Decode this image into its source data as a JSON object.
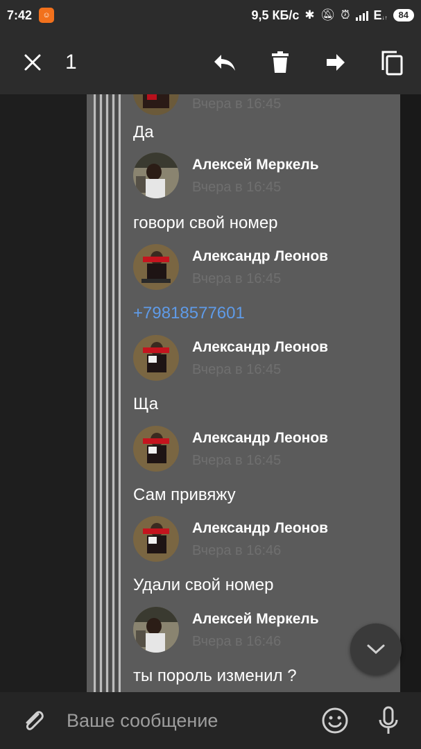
{
  "status_bar": {
    "time": "7:42",
    "network_speed": "9,5 КБ/с",
    "network_type": "E",
    "network_sub": "↓↑",
    "battery": "84"
  },
  "toolbar": {
    "selected_count": "1",
    "icons": [
      "close-icon",
      "reply-icon",
      "delete-icon",
      "forward-icon",
      "copy-icon"
    ]
  },
  "chat": {
    "top_partial_time": "Вчера в 16:45",
    "messages": [
      {
        "text": "Да"
      },
      {
        "author": "Алексей Меркель",
        "time": "Вчера в 16:45",
        "text": "говори свой номер"
      },
      {
        "author": "Александр Леонов",
        "time": "Вчера в 16:45",
        "text": "+79818577601"
      },
      {
        "author": "Александр Леонов",
        "time": "Вчера в 16:45",
        "text": "Ща"
      },
      {
        "author": "Александр Леонов",
        "time": "Вчера в 16:45",
        "text": "Сам привяжу"
      },
      {
        "author": "Александр Леонов",
        "time": "Вчера в 16:46",
        "text": "Удали свой номер"
      },
      {
        "author": "Алексей Меркель",
        "time": "Вчера в 16:46",
        "text": "ты пороль изменил ?"
      }
    ]
  },
  "input": {
    "placeholder": "Ваше сообщение"
  },
  "colors": {
    "toolbar_bg": "#2c2c2c",
    "selected_bg": "#5b5b5b",
    "link": "#5f9be8",
    "time_text": "#6f6f6f"
  }
}
